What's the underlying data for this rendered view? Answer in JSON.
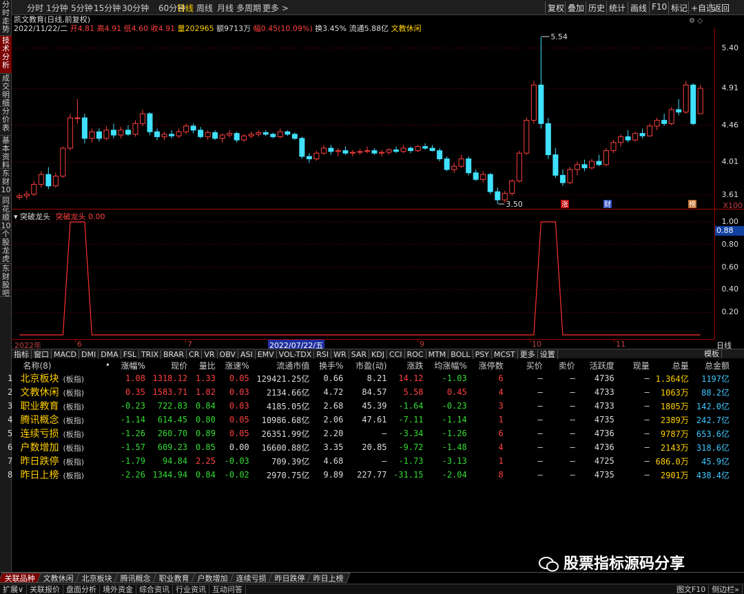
{
  "sidebar": {
    "tabs": [
      {
        "label": "分时走势",
        "active": false
      },
      {
        "label": "技术分析",
        "active": true
      },
      {
        "label": "成交明细",
        "active": false
      },
      {
        "label": "分价表",
        "active": false
      },
      {
        "label": "基本资料",
        "active": false
      },
      {
        "label": "东财10",
        "active": false
      },
      {
        "label": "同花顺10",
        "active": false
      },
      {
        "label": "个股龙虎",
        "active": false
      },
      {
        "label": "东财股吧",
        "active": false
      }
    ]
  },
  "topbar": {
    "periods": [
      "分时",
      "1分钟",
      "5分钟",
      "15分钟",
      "30分钟",
      "60分钟",
      "日线",
      "周线",
      "月线",
      "多周期",
      "更多 >"
    ],
    "active_period": "日线",
    "buttons": [
      "复权",
      "叠加",
      "历史",
      "统计",
      "画线",
      "F10",
      "标记",
      "+自选",
      "返回"
    ]
  },
  "info": {
    "title": "凯文教育(日线,前复权)",
    "date": "2022/11/22/二",
    "open_label": "开",
    "open": "4.81",
    "high_label": "高",
    "high": "4.91",
    "low_label": "低",
    "low": "4.60",
    "close_label": "收",
    "close": "4.91",
    "vol_label": "量",
    "vol": "202965",
    "amt_label": "额",
    "amt": "9713万",
    "chg_label": "幅",
    "chg": "0.45(10.09%)",
    "turn_label": "换",
    "turn": "3.45%",
    "float_label": "流通",
    "float": "5.88亿",
    "sector": "文教休闲"
  },
  "main_chart": {
    "y_ticks": [
      "5.40",
      "4.91",
      "4.46",
      "4.01",
      "3.61"
    ],
    "hi_label": "5.54",
    "lo_label": "3.50",
    "markers": [
      "涨",
      "财",
      "榜"
    ],
    "zoom": "X100"
  },
  "indicator": {
    "name": "突破龙头",
    "sub_name": "突破龙头",
    "value": "0.00",
    "y_ticks": [
      "1.00",
      "0.80",
      "0.60",
      "0.40",
      "0.20"
    ],
    "current": "0.88"
  },
  "date_axis": {
    "labels": [
      "2022年",
      "6",
      "7",
      "2022/07/22/五",
      "9",
      "10",
      "11"
    ],
    "right_label": "日线"
  },
  "indicator_tabs": [
    "指标",
    "窗口",
    "MACD",
    "DMI",
    "DMA",
    "FSL",
    "TRIX",
    "BRAR",
    "CR",
    "VR",
    "OBV",
    "ASI",
    "EMV",
    "VOL-TDX",
    "RSI",
    "WR",
    "SAR",
    "KDJ",
    "CCI",
    "ROC",
    "MTM",
    "BOLL",
    "PSY",
    "MCST",
    "更多",
    "设置"
  ],
  "indicator_tabs_right": "模板",
  "table": {
    "headers": [
      "",
      "名称(8)",
      "•",
      "涨幅%",
      "现价",
      "量比",
      "涨速%",
      "流通市值",
      "换手%",
      "市盈(动)",
      "涨跌",
      "均涨幅%",
      "涨停数",
      "买价",
      "卖价",
      "活跃度",
      "现量",
      "总量",
      "总金额"
    ],
    "rows": [
      {
        "idx": "1",
        "name": "北京板块",
        "sub": "(板指)",
        "chg": "1.08",
        "price": "1318.12",
        "lb": "1.33",
        "speed": "0.05",
        "mcap": "129421.25亿",
        "turn": "0.66",
        "pe": "8.21",
        "diff": "14.12",
        "avg": "-1.03",
        "zt": "6",
        "bid": "—",
        "ask": "—",
        "act": "4736",
        "cur": "—",
        "vol": "1.364亿",
        "amt": "1197亿"
      },
      {
        "idx": "2",
        "name": "文教休闲",
        "sub": "(板指)",
        "chg": "0.35",
        "price": "1583.71",
        "lb": "1.02",
        "speed": "0.03",
        "mcap": "2134.66亿",
        "turn": "4.72",
        "pe": "84.57",
        "diff": "5.58",
        "avg": "0.45",
        "zt": "4",
        "bid": "—",
        "ask": "—",
        "act": "4733",
        "cur": "—",
        "vol": "1063万",
        "amt": "88.2亿"
      },
      {
        "idx": "3",
        "name": "职业教育",
        "sub": "(板指)",
        "chg": "-0.23",
        "price": "722.83",
        "lb": "0.84",
        "speed": "0.03",
        "mcap": "4185.05亿",
        "turn": "2.68",
        "pe": "45.39",
        "diff": "-1.64",
        "avg": "-0.23",
        "zt": "3",
        "bid": "—",
        "ask": "—",
        "act": "4733",
        "cur": "—",
        "vol": "1805万",
        "amt": "142.0亿"
      },
      {
        "idx": "4",
        "name": "腾讯概念",
        "sub": "(板指)",
        "chg": "-1.14",
        "price": "614.45",
        "lb": "0.80",
        "speed": "0.05",
        "mcap": "10986.68亿",
        "turn": "2.06",
        "pe": "47.61",
        "diff": "-7.11",
        "avg": "-1.14",
        "zt": "1",
        "bid": "—",
        "ask": "—",
        "act": "4735",
        "cur": "—",
        "vol": "2389万",
        "amt": "242.7亿"
      },
      {
        "idx": "5",
        "name": "连续亏损",
        "sub": "(板指)",
        "chg": "-1.26",
        "price": "260.70",
        "lb": "0.89",
        "speed": "0.05",
        "mcap": "26351.99亿",
        "turn": "2.20",
        "pe": "—",
        "diff": "-3.34",
        "avg": "-1.26",
        "zt": "6",
        "bid": "—",
        "ask": "—",
        "act": "4736",
        "cur": "—",
        "vol": "9787万",
        "amt": "653.6亿"
      },
      {
        "idx": "6",
        "name": "户数增加",
        "sub": "(板指)",
        "chg": "-1.57",
        "price": "609.23",
        "lb": "0.85",
        "speed": "0.00",
        "mcap": "16600.88亿",
        "turn": "3.35",
        "pe": "20.85",
        "diff": "-9.72",
        "avg": "-1.48",
        "zt": "4",
        "bid": "—",
        "ask": "—",
        "act": "4736",
        "cur": "—",
        "vol": "2143万",
        "amt": "318.6亿"
      },
      {
        "idx": "7",
        "name": "昨日跌停",
        "sub": "(板指)",
        "chg": "-1.79",
        "price": "94.84",
        "lb": "2.25",
        "speed": "-0.03",
        "mcap": "709.39亿",
        "turn": "4.68",
        "pe": "—",
        "diff": "-1.73",
        "avg": "-3.13",
        "zt": "1",
        "bid": "—",
        "ask": "—",
        "act": "4725",
        "cur": "—",
        "vol": "686.0万",
        "amt": "45.9亿"
      },
      {
        "idx": "8",
        "name": "昨日上榜",
        "sub": "(板指)",
        "chg": "-2.26",
        "price": "1344.94",
        "lb": "0.84",
        "speed": "-0.02",
        "mcap": "2970.75亿",
        "turn": "9.89",
        "pe": "227.77",
        "diff": "-31.15",
        "avg": "-2.04",
        "zt": "8",
        "bid": "—",
        "ask": "—",
        "act": "4735",
        "cur": "—",
        "vol": "2901万",
        "amt": "438.4亿"
      }
    ]
  },
  "bottom_tabs": [
    "关联品种",
    "文教休闲",
    "北京板块",
    "腾讯概念",
    "职业教育",
    "户数增加",
    "连续亏损",
    "昨日跌停",
    "昨日上榜"
  ],
  "status_items": [
    "扩展∨",
    "关联报价",
    "盘面分析",
    "境外资金",
    "综合资讯",
    "行业资讯",
    "互动问答"
  ],
  "status_right": [
    "图文F10",
    "侧边栏»"
  ],
  "watermark": "股票指标源码分享",
  "colors": {
    "up": "#ff4040",
    "down": "#33dd33",
    "flat": "#dddddd",
    "candle_down": "#40e0ff",
    "axis": "#a00000",
    "highlight": "#ffd000"
  },
  "chart_data": {
    "type": "candlestick",
    "series": [
      {
        "o": 3.58,
        "h": 3.63,
        "l": 3.55,
        "c": 3.6
      },
      {
        "o": 3.6,
        "h": 3.66,
        "l": 3.56,
        "c": 3.62
      },
      {
        "o": 3.62,
        "h": 3.78,
        "l": 3.6,
        "c": 3.74
      },
      {
        "o": 3.74,
        "h": 3.9,
        "l": 3.7,
        "c": 3.86
      },
      {
        "o": 3.86,
        "h": 3.95,
        "l": 3.68,
        "c": 3.72
      },
      {
        "o": 3.72,
        "h": 3.88,
        "l": 3.7,
        "c": 3.84
      },
      {
        "o": 3.84,
        "h": 4.2,
        "l": 3.82,
        "c": 4.18
      },
      {
        "o": 4.18,
        "h": 4.6,
        "l": 4.15,
        "c": 4.55
      },
      {
        "o": 4.55,
        "h": 4.78,
        "l": 4.48,
        "c": 4.55
      },
      {
        "o": 4.55,
        "h": 4.6,
        "l": 4.24,
        "c": 4.3
      },
      {
        "o": 4.3,
        "h": 4.42,
        "l": 4.25,
        "c": 4.38
      },
      {
        "o": 4.38,
        "h": 4.42,
        "l": 4.26,
        "c": 4.3
      },
      {
        "o": 4.3,
        "h": 4.45,
        "l": 4.28,
        "c": 4.4
      },
      {
        "o": 4.4,
        "h": 4.48,
        "l": 4.3,
        "c": 4.34
      },
      {
        "o": 4.34,
        "h": 4.44,
        "l": 4.3,
        "c": 4.4
      },
      {
        "o": 4.4,
        "h": 4.46,
        "l": 4.33,
        "c": 4.35
      },
      {
        "o": 4.35,
        "h": 4.52,
        "l": 4.32,
        "c": 4.48
      },
      {
        "o": 4.48,
        "h": 4.65,
        "l": 4.45,
        "c": 4.6
      },
      {
        "o": 4.6,
        "h": 4.62,
        "l": 4.34,
        "c": 4.38
      },
      {
        "o": 4.38,
        "h": 4.42,
        "l": 4.28,
        "c": 4.32
      },
      {
        "o": 4.32,
        "h": 4.38,
        "l": 4.28,
        "c": 4.35
      },
      {
        "o": 4.35,
        "h": 4.4,
        "l": 4.3,
        "c": 4.33
      },
      {
        "o": 4.33,
        "h": 4.42,
        "l": 4.3,
        "c": 4.38
      },
      {
        "o": 4.38,
        "h": 4.48,
        "l": 4.35,
        "c": 4.45
      },
      {
        "o": 4.45,
        "h": 4.48,
        "l": 4.36,
        "c": 4.4
      },
      {
        "o": 4.4,
        "h": 4.44,
        "l": 4.3,
        "c": 4.32
      },
      {
        "o": 4.32,
        "h": 4.4,
        "l": 4.28,
        "c": 4.37
      },
      {
        "o": 4.37,
        "h": 4.4,
        "l": 4.28,
        "c": 4.3
      },
      {
        "o": 4.3,
        "h": 4.36,
        "l": 4.25,
        "c": 4.34
      },
      {
        "o": 4.34,
        "h": 4.4,
        "l": 4.31,
        "c": 4.36
      },
      {
        "o": 4.36,
        "h": 4.38,
        "l": 4.25,
        "c": 4.28
      },
      {
        "o": 4.28,
        "h": 4.35,
        "l": 4.26,
        "c": 4.33
      },
      {
        "o": 4.33,
        "h": 4.38,
        "l": 4.3,
        "c": 4.35
      },
      {
        "o": 4.35,
        "h": 4.4,
        "l": 4.32,
        "c": 4.37
      },
      {
        "o": 4.37,
        "h": 4.4,
        "l": 4.33,
        "c": 4.35
      },
      {
        "o": 4.35,
        "h": 4.37,
        "l": 4.3,
        "c": 4.32
      },
      {
        "o": 4.32,
        "h": 4.42,
        "l": 4.3,
        "c": 4.38
      },
      {
        "o": 4.38,
        "h": 4.4,
        "l": 4.33,
        "c": 4.35
      },
      {
        "o": 4.35,
        "h": 4.37,
        "l": 4.28,
        "c": 4.3
      },
      {
        "o": 4.3,
        "h": 4.32,
        "l": 4.05,
        "c": 4.08
      },
      {
        "o": 4.08,
        "h": 4.12,
        "l": 4.0,
        "c": 4.05
      },
      {
        "o": 4.05,
        "h": 4.15,
        "l": 4.03,
        "c": 4.12
      },
      {
        "o": 4.12,
        "h": 4.22,
        "l": 4.1,
        "c": 4.18
      },
      {
        "o": 4.18,
        "h": 4.22,
        "l": 4.1,
        "c": 4.14
      },
      {
        "o": 4.14,
        "h": 4.18,
        "l": 4.08,
        "c": 4.15
      },
      {
        "o": 4.15,
        "h": 4.2,
        "l": 4.1,
        "c": 4.12
      },
      {
        "o": 4.12,
        "h": 4.16,
        "l": 4.08,
        "c": 4.13
      },
      {
        "o": 4.13,
        "h": 4.17,
        "l": 4.1,
        "c": 4.14
      },
      {
        "o": 4.14,
        "h": 4.2,
        "l": 4.12,
        "c": 4.15
      },
      {
        "o": 4.15,
        "h": 4.18,
        "l": 4.1,
        "c": 4.12
      },
      {
        "o": 4.12,
        "h": 4.16,
        "l": 4.08,
        "c": 4.13
      },
      {
        "o": 4.13,
        "h": 4.18,
        "l": 4.1,
        "c": 4.16
      },
      {
        "o": 4.16,
        "h": 4.2,
        "l": 4.12,
        "c": 4.14
      },
      {
        "o": 4.14,
        "h": 4.22,
        "l": 4.12,
        "c": 4.18
      },
      {
        "o": 4.18,
        "h": 4.2,
        "l": 4.12,
        "c": 4.15
      },
      {
        "o": 4.15,
        "h": 4.22,
        "l": 4.13,
        "c": 4.2
      },
      {
        "o": 4.2,
        "h": 4.24,
        "l": 4.16,
        "c": 4.18
      },
      {
        "o": 4.18,
        "h": 4.22,
        "l": 4.14,
        "c": 4.15
      },
      {
        "o": 4.15,
        "h": 4.18,
        "l": 4.02,
        "c": 4.05
      },
      {
        "o": 4.05,
        "h": 4.08,
        "l": 3.9,
        "c": 3.92
      },
      {
        "o": 3.92,
        "h": 4.0,
        "l": 3.88,
        "c": 3.96
      },
      {
        "o": 3.96,
        "h": 4.1,
        "l": 3.94,
        "c": 4.05
      },
      {
        "o": 4.05,
        "h": 4.08,
        "l": 3.85,
        "c": 3.88
      },
      {
        "o": 3.88,
        "h": 3.92,
        "l": 3.78,
        "c": 3.8
      },
      {
        "o": 3.8,
        "h": 3.9,
        "l": 3.76,
        "c": 3.86
      },
      {
        "o": 3.86,
        "h": 3.88,
        "l": 3.62,
        "c": 3.65
      },
      {
        "o": 3.65,
        "h": 3.7,
        "l": 3.5,
        "c": 3.55
      },
      {
        "o": 3.55,
        "h": 3.66,
        "l": 3.52,
        "c": 3.63
      },
      {
        "o": 3.63,
        "h": 3.8,
        "l": 3.6,
        "c": 3.78
      },
      {
        "o": 3.78,
        "h": 4.15,
        "l": 3.76,
        "c": 4.12
      },
      {
        "o": 4.12,
        "h": 4.55,
        "l": 4.1,
        "c": 4.52
      },
      {
        "o": 4.52,
        "h": 5.0,
        "l": 4.48,
        "c": 4.95
      },
      {
        "o": 4.95,
        "h": 5.54,
        "l": 4.42,
        "c": 4.48
      },
      {
        "o": 4.48,
        "h": 4.55,
        "l": 4.05,
        "c": 4.1
      },
      {
        "o": 4.1,
        "h": 4.18,
        "l": 3.82,
        "c": 3.85
      },
      {
        "o": 3.85,
        "h": 3.92,
        "l": 3.72,
        "c": 3.76
      },
      {
        "o": 3.76,
        "h": 3.95,
        "l": 3.74,
        "c": 3.92
      },
      {
        "o": 3.92,
        "h": 4.02,
        "l": 3.85,
        "c": 3.98
      },
      {
        "o": 3.98,
        "h": 4.04,
        "l": 3.9,
        "c": 3.94
      },
      {
        "o": 3.94,
        "h": 4.05,
        "l": 3.92,
        "c": 4.02
      },
      {
        "o": 4.02,
        "h": 4.1,
        "l": 3.96,
        "c": 3.98
      },
      {
        "o": 3.98,
        "h": 4.18,
        "l": 3.96,
        "c": 4.15
      },
      {
        "o": 4.15,
        "h": 4.28,
        "l": 4.12,
        "c": 4.25
      },
      {
        "o": 4.25,
        "h": 4.35,
        "l": 4.2,
        "c": 4.32
      },
      {
        "o": 4.32,
        "h": 4.4,
        "l": 4.25,
        "c": 4.28
      },
      {
        "o": 4.28,
        "h": 4.38,
        "l": 4.26,
        "c": 4.36
      },
      {
        "o": 4.36,
        "h": 4.42,
        "l": 4.3,
        "c": 4.33
      },
      {
        "o": 4.33,
        "h": 4.48,
        "l": 4.32,
        "c": 4.45
      },
      {
        "o": 4.45,
        "h": 4.55,
        "l": 4.4,
        "c": 4.52
      },
      {
        "o": 4.52,
        "h": 4.6,
        "l": 4.45,
        "c": 4.48
      },
      {
        "o": 4.48,
        "h": 4.68,
        "l": 4.46,
        "c": 4.65
      },
      {
        "o": 4.65,
        "h": 4.78,
        "l": 4.58,
        "c": 4.62
      },
      {
        "o": 4.62,
        "h": 5.0,
        "l": 4.6,
        "c": 4.95
      },
      {
        "o": 4.95,
        "h": 4.97,
        "l": 4.46,
        "c": 4.48
      },
      {
        "o": 4.6,
        "h": 4.95,
        "l": 4.6,
        "c": 4.91
      }
    ],
    "indicator_peaks": [
      {
        "start": 7,
        "end": 9
      },
      {
        "start": 72,
        "end": 74
      }
    ],
    "ylim": [
      3.45,
      5.65
    ]
  }
}
